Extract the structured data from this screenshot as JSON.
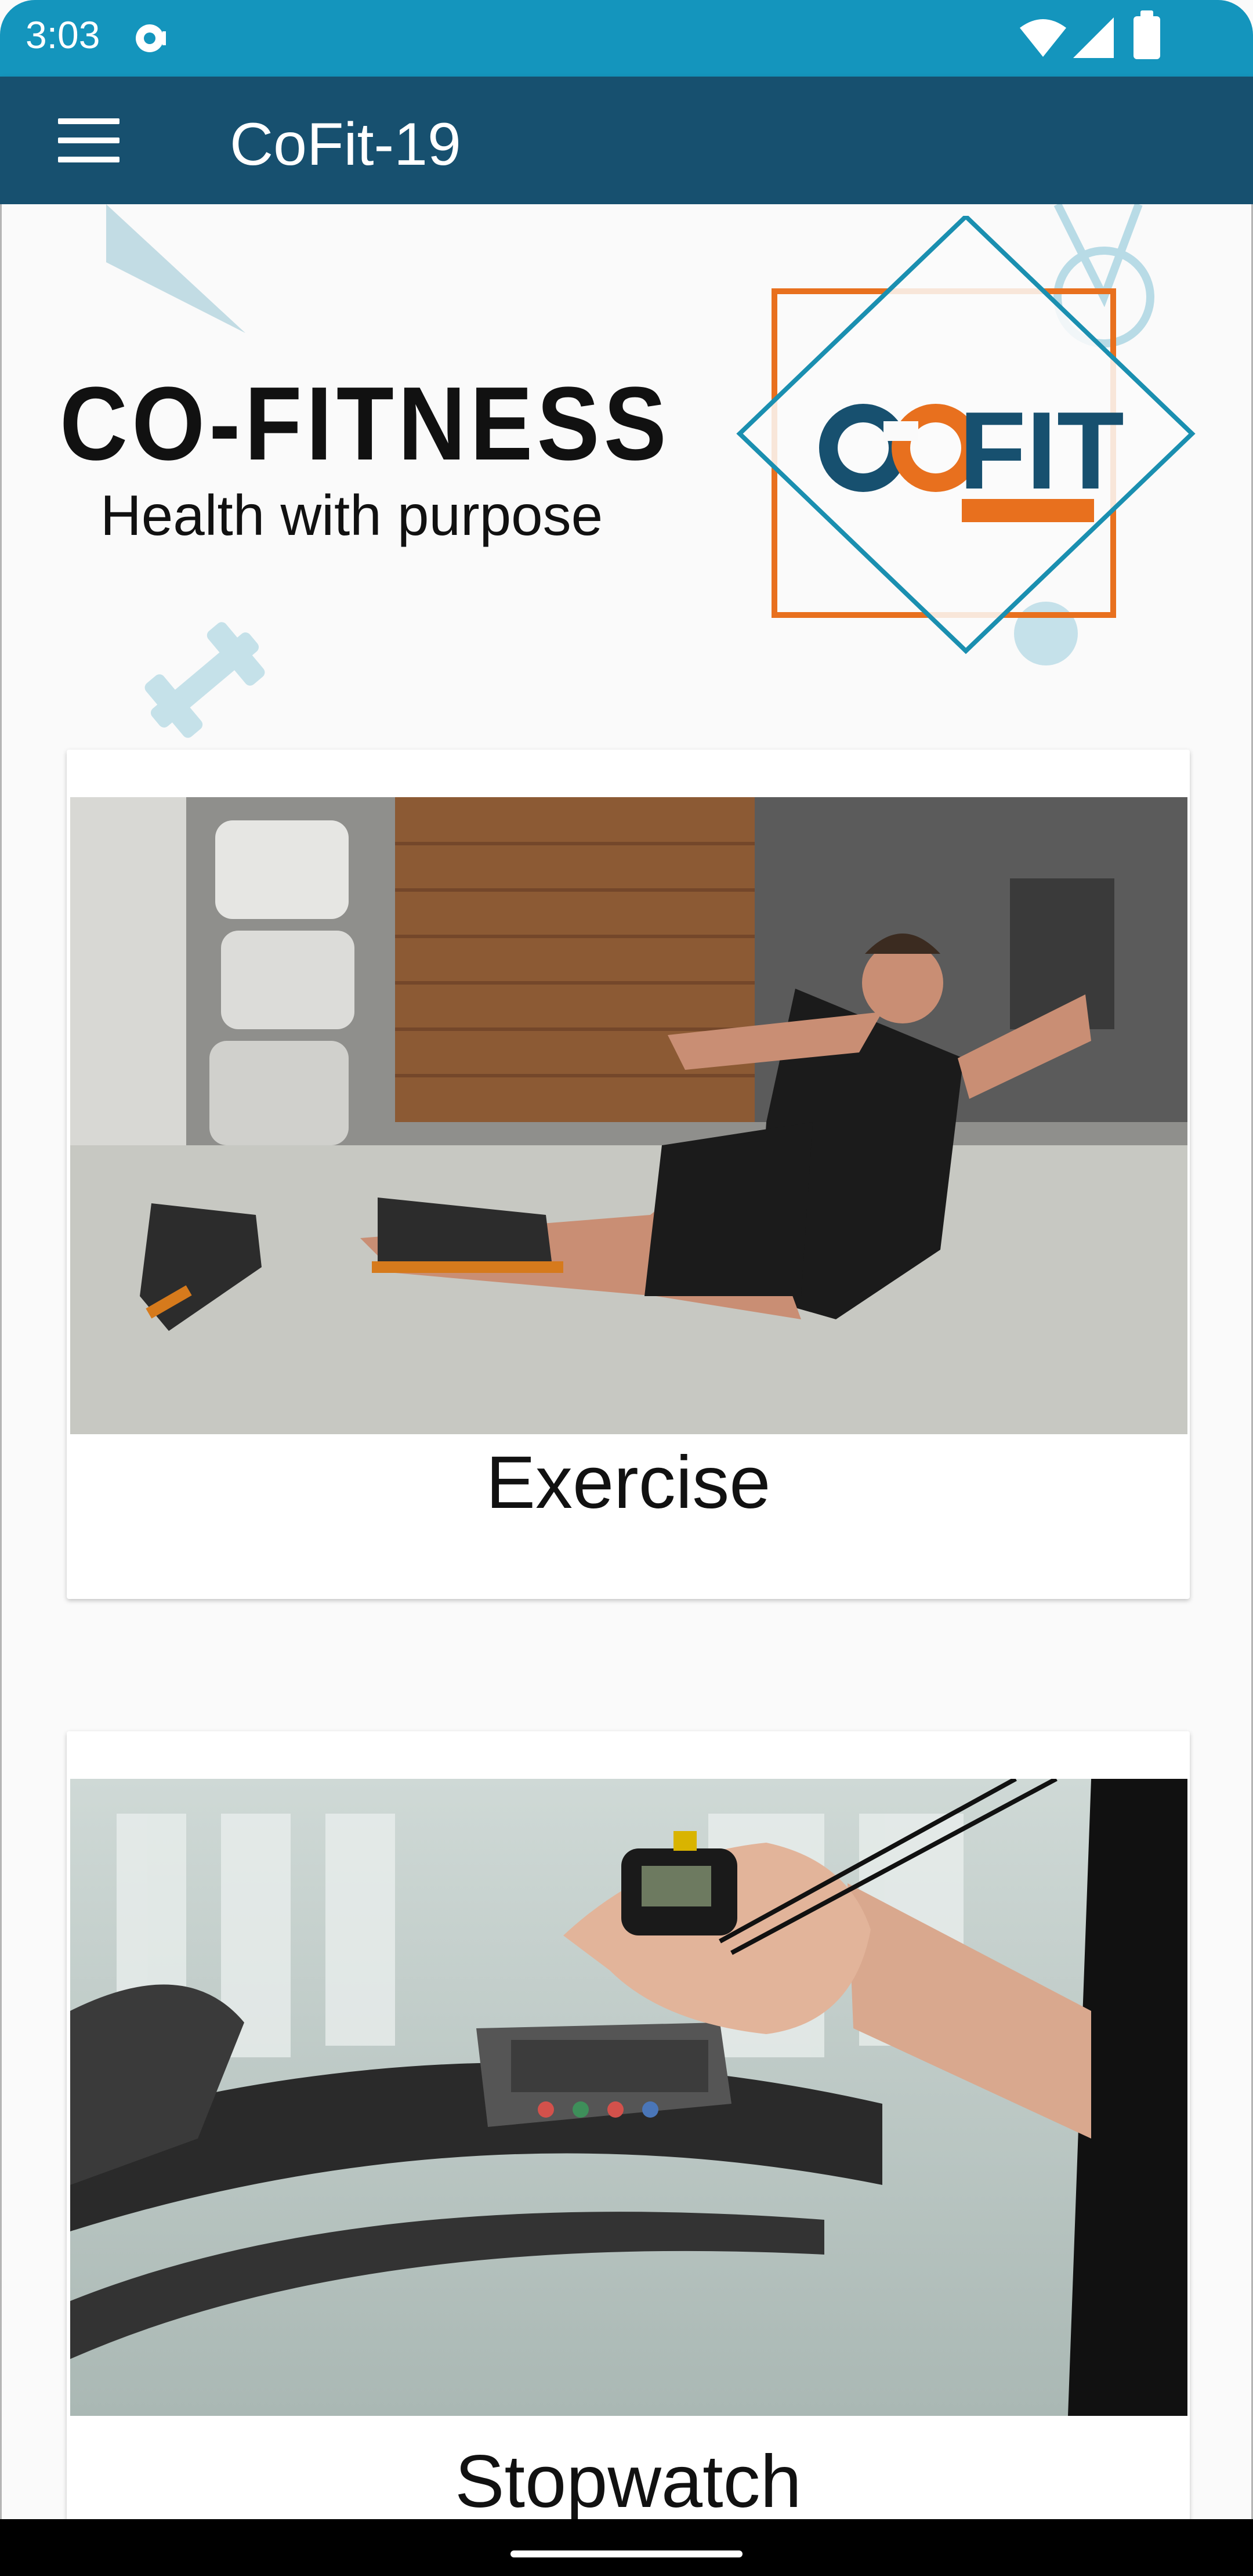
{
  "status_bar": {
    "time": "3:03",
    "icons": [
      "notification-icon",
      "wifi-icon",
      "signal-icon",
      "battery-icon"
    ]
  },
  "app_bar": {
    "title": "CoFit-19",
    "menu_icon": "menu-icon"
  },
  "banner": {
    "title": "CO-FITNESS",
    "subtitle": "Health with purpose",
    "logo_text": "FIT"
  },
  "cards": [
    {
      "label": "Exercise",
      "image": "man doing sit-ups on gym floor"
    },
    {
      "label": "Stopwatch",
      "image": "hand holding stopwatch over treadmill"
    }
  ],
  "colors": {
    "status_bar": "#1495bd",
    "app_bar": "#17506f",
    "logo_orange": "#e8701e",
    "logo_blue": "#1a8fb0",
    "logo_navy": "#17506f"
  }
}
